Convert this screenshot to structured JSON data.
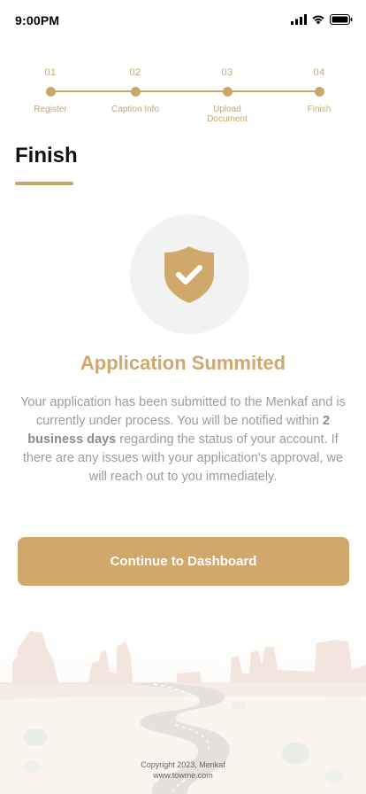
{
  "status_bar": {
    "time": "9:00PM",
    "icons": [
      "signal-icon",
      "wifi-icon",
      "battery-icon"
    ]
  },
  "stepper": {
    "steps": [
      {
        "number": "01",
        "label": "Register"
      },
      {
        "number": "02",
        "label": "Caption Info"
      },
      {
        "number": "03",
        "label": "Upload Document"
      },
      {
        "number": "04",
        "label": "Finish"
      }
    ],
    "current_step": 4
  },
  "page": {
    "title": "Finish"
  },
  "success": {
    "icon": "shield-check-icon",
    "title": "Application Summited",
    "message_part1": "Your application has been submitted to the Menkaf and is currently under process. You will be notified within ",
    "message_bold": "2 business days",
    "message_part2": " regarding the status of your account.  If there are any issues with your application's approval, we will reach out to you immediately."
  },
  "cta": {
    "label": "Continue to Dashboard"
  },
  "footer": {
    "copyright": "Copyright 2023, Menkaf",
    "website": "www.towme.com"
  },
  "colors": {
    "accent": "#d1a86c",
    "stepper": "#c9a66b",
    "circle_bg": "#f2f2f2",
    "body_text": "#9c9c9c"
  }
}
